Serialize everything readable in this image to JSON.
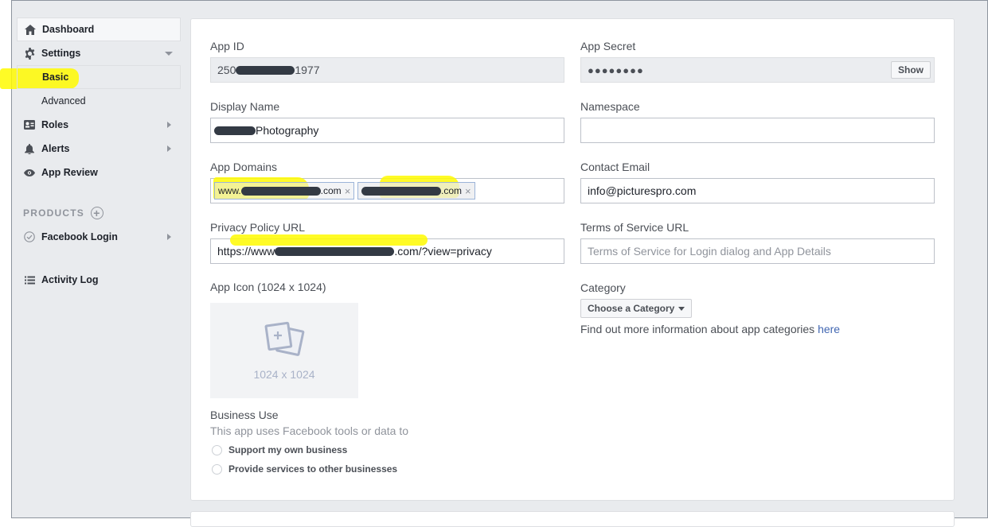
{
  "sidebar": {
    "items": [
      {
        "label": "Dashboard"
      },
      {
        "label": "Settings"
      },
      {
        "label": "Basic"
      },
      {
        "label": "Advanced"
      },
      {
        "label": "Roles"
      },
      {
        "label": "Alerts"
      },
      {
        "label": "App Review"
      }
    ],
    "products_header": "PRODUCTS",
    "products": [
      {
        "label": "Facebook Login"
      }
    ],
    "activity_log": "Activity Log"
  },
  "form": {
    "app_id": {
      "label": "App ID",
      "value_start": "250",
      "value_end": "1977"
    },
    "app_secret": {
      "label": "App Secret",
      "value": "●●●●●●●●",
      "show_button": "Show"
    },
    "display_name": {
      "label": "Display Name",
      "value_end": "Photography"
    },
    "namespace": {
      "label": "Namespace",
      "value": ""
    },
    "app_domains": {
      "label": "App Domains",
      "tags": [
        {
          "start": "www.",
          "end": ".com"
        },
        {
          "start": "",
          "end": ".com"
        }
      ],
      "remove": "×"
    },
    "contact_email": {
      "label": "Contact Email",
      "value": "info@picturespro.com"
    },
    "privacy_policy_url": {
      "label": "Privacy Policy URL",
      "value_start": "https://www",
      "value_end": ".com/?view=privacy"
    },
    "terms_of_service_url": {
      "label": "Terms of Service URL",
      "placeholder": "Terms of Service for Login dialog and App Details"
    },
    "app_icon": {
      "label": "App Icon (1024 x 1024)",
      "caption": "1024 x 1024"
    },
    "category": {
      "label": "Category",
      "dropdown": "Choose a Category",
      "info": "Find out more information about app categories ",
      "info_link": "here"
    },
    "business_use": {
      "label": "Business Use",
      "description": "This app uses Facebook tools or data to",
      "options": [
        "Support my own business",
        "Provide services to other businesses"
      ]
    }
  },
  "colors": {
    "highlight": "#fffa00",
    "link": "#4267b2",
    "redaction": "#333a44"
  }
}
